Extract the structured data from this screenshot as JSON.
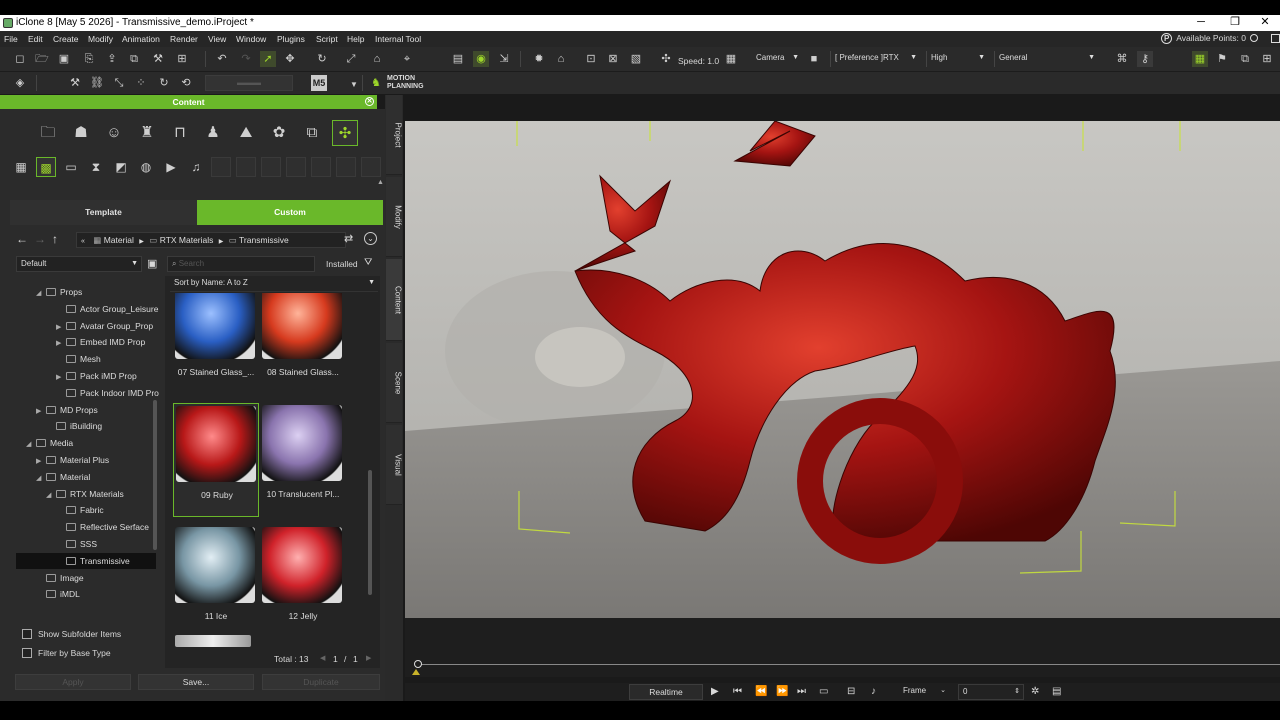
{
  "window": {
    "title": "iClone 8 [May  5 2026] - Transmissive_demo.iProject *",
    "minimize": "─",
    "maximize": "❐",
    "close": "✕"
  },
  "menu": [
    "File",
    "Edit",
    "Create",
    "Modify",
    "Animation",
    "Render",
    "View",
    "Window",
    "Plugins",
    "Script",
    "Help",
    "Internal Tool"
  ],
  "points": {
    "label": "Available Points: 0",
    "icon": "P"
  },
  "toolbar": {
    "speed_label": "Speed: 1.0",
    "camera": "Camera",
    "preference": "[ Preference ]RTX",
    "quality": "High",
    "mode": "General",
    "motion_planning_line1": "MOTION",
    "motion_planning_line2": "PLANNING",
    "m5_label": "M5"
  },
  "content": {
    "header": "Content",
    "tabs": {
      "template": "Template",
      "custom": "Custom"
    },
    "breadcrumb": [
      "Material",
      "RTX Materials",
      "Transmissive"
    ],
    "preset": "Default",
    "search_placeholder": "Search",
    "installed": "Installed",
    "sort": "Sort by Name: A to Z",
    "tree": [
      {
        "label": "Props",
        "indent": 2,
        "twisty": "◢",
        "icon": "props"
      },
      {
        "label": "Actor Group_Leisure",
        "indent": 4,
        "twisty": "",
        "icon": "folder"
      },
      {
        "label": "Avatar Group_Prop",
        "indent": 4,
        "twisty": "▶",
        "icon": "folder"
      },
      {
        "label": "Embed IMD Prop",
        "indent": 4,
        "twisty": "▶",
        "icon": "folder"
      },
      {
        "label": "Mesh",
        "indent": 4,
        "twisty": "",
        "icon": "folder"
      },
      {
        "label": "Pack iMD Prop",
        "indent": 4,
        "twisty": "▶",
        "icon": "folder"
      },
      {
        "label": "Pack Indoor IMD Pro",
        "indent": 4,
        "twisty": "",
        "icon": "folder"
      },
      {
        "label": "MD Props",
        "indent": 2,
        "twisty": "▶",
        "icon": "props"
      },
      {
        "label": "iBuilding",
        "indent": 3,
        "twisty": "",
        "icon": "props"
      },
      {
        "label": "Media",
        "indent": 1,
        "twisty": "◢",
        "icon": "media"
      },
      {
        "label": "Material Plus",
        "indent": 2,
        "twisty": "▶",
        "icon": "grid"
      },
      {
        "label": "Material",
        "indent": 2,
        "twisty": "◢",
        "icon": "grid"
      },
      {
        "label": "RTX Materials",
        "indent": 3,
        "twisty": "◢",
        "icon": "folder"
      },
      {
        "label": "Fabric",
        "indent": 4,
        "twisty": "",
        "icon": "folder"
      },
      {
        "label": "Reflective Serface",
        "indent": 4,
        "twisty": "",
        "icon": "folder"
      },
      {
        "label": "SSS",
        "indent": 4,
        "twisty": "",
        "icon": "folder"
      },
      {
        "label": "Transmissive",
        "indent": 4,
        "twisty": "",
        "icon": "folder",
        "selected": true
      },
      {
        "label": "Image",
        "indent": 2,
        "twisty": "",
        "icon": "props"
      },
      {
        "label": "iMDL",
        "indent": 2,
        "twisty": "",
        "icon": "props"
      }
    ],
    "items": [
      {
        "label": "07 Stained Glass_...",
        "color": "#2a5fc4",
        "hi": "#9cc0ff"
      },
      {
        "label": "08 Stained Glass...",
        "color": "#d63a1e",
        "hi": "#ffb49a"
      },
      {
        "label": "09 Ruby",
        "color": "#b81818",
        "hi": "#ff8a8a",
        "selected": true
      },
      {
        "label": "10 Translucent Pl...",
        "color": "#8a74ae",
        "hi": "#dcd0f2"
      },
      {
        "label": "11 Ice",
        "color": "#7896a4",
        "hi": "#e2eef4"
      },
      {
        "label": "12 Jelly",
        "color": "#d0222a",
        "hi": "#ffb0b0"
      }
    ],
    "total": "Total : 13",
    "page": "1",
    "page_sep": "/",
    "pages": "1",
    "show_subfolder": "Show Subfolder Items",
    "filter_base": "Filter by Base Type",
    "apply": "Apply",
    "save": "Save...",
    "duplicate": "Duplicate"
  },
  "side_tabs": [
    "Project",
    "Modify",
    "Content",
    "Scene",
    "Visual"
  ],
  "playback": {
    "mode": "Realtime",
    "frame_label": "Frame",
    "frame_value": "0"
  },
  "colors": {
    "accent": "#6ab82a",
    "ruby": "#b81818"
  }
}
